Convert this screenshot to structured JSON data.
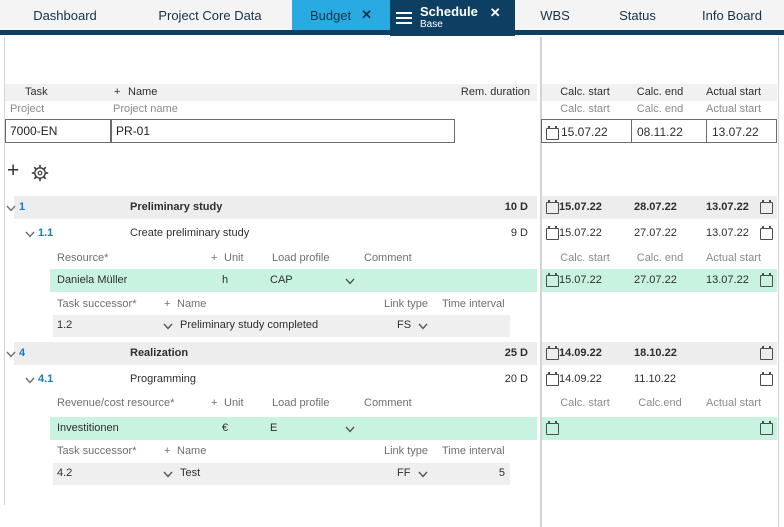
{
  "tabs": {
    "dashboard": "Dashboard",
    "project_core_data": "Project Core Data",
    "budget": "Budget",
    "budget_close": "✕",
    "schedule": "Schedule",
    "schedule_sub": "Base",
    "schedule_close": "✕",
    "wbs": "WBS",
    "status": "Status",
    "info_board": "Info Board"
  },
  "colors": {
    "accent_blue": "#29abe2",
    "navy": "#0d3f63",
    "mint_row": "#c8f3e1",
    "gray_row": "#ededee",
    "task_number_blue": "#1878c2"
  },
  "header": {
    "task": "Task",
    "plus": "+",
    "name": "Name",
    "rem_duration": "Rem. duration",
    "calc_start": "Calc. start",
    "calc_end": "Calc. end",
    "actual_start": "Actual start"
  },
  "project_row": {
    "task_label": "Project",
    "name_label": "Project name",
    "calc_start": "Calc. start",
    "calc_end": "Calc. end",
    "actual_start": "Actual start"
  },
  "project": {
    "id": "7000-EN",
    "name": "PR-01",
    "calc_start": "15.07.22",
    "calc_end": "08.11.22",
    "actual_start": "13.07.22"
  },
  "tasks": {
    "r1": {
      "num": "1",
      "name": "Preliminary study",
      "dur": "10 D",
      "calc_start": "15.07.22",
      "calc_end": "28.07.22",
      "actual_start": "13.07.22"
    },
    "r11": {
      "num": "1.1",
      "name": "Create preliminary study",
      "dur": "9 D",
      "calc_start": "15.07.22",
      "calc_end": "27.07.22",
      "actual_start": "13.07.22"
    },
    "r4": {
      "num": "4",
      "name": "Realization",
      "dur": "25 D",
      "calc_start": "14.09.22",
      "calc_end": "18.10.22",
      "actual_start": ""
    },
    "r41": {
      "num": "4.1",
      "name": "Programming",
      "dur": "20 D",
      "calc_start": "14.09.22",
      "calc_end": "11.10.22",
      "actual_start": ""
    }
  },
  "resource_section": {
    "header": {
      "col1": "Resource*",
      "plus": "+",
      "unit": "Unit",
      "load_profile": "Load profile",
      "comment": "Comment",
      "calc_start": "Calc. start",
      "calc_end": "Calc. end",
      "actual_start": "Actual start"
    },
    "row": {
      "name": "Daniela Müller",
      "unit": "h",
      "load_profile": "CAP",
      "calc_start": "15.07.22",
      "calc_end": "27.07.22",
      "actual_start": "13.07.22"
    }
  },
  "successor_section1": {
    "header": {
      "col1": "Task successor*",
      "plus": "+",
      "name": "Name",
      "link_type": "Link type",
      "time_interval": "Time interval"
    },
    "row": {
      "id": "1.2",
      "name": "Preliminary study completed",
      "link_type": "FS",
      "time_interval": ""
    }
  },
  "revenue_section": {
    "header": {
      "col1": "Revenue/cost resource*",
      "plus": "+",
      "unit": "Unit",
      "load_profile": "Load profile",
      "comment": "Comment",
      "calc_start": "Calc. start",
      "calc_end": "Calc.end",
      "actual_start": "Actual start"
    },
    "row": {
      "name": "Investitionen",
      "unit": "€",
      "load_profile": "E",
      "calc_start": "",
      "calc_end": "",
      "actual_start": ""
    }
  },
  "successor_section2": {
    "header": {
      "col1": "Task successor*",
      "plus": "+",
      "name": "Name",
      "link_type": "Link type",
      "time_interval": "Time interval"
    },
    "row": {
      "id": "4.2",
      "name": "Test",
      "link_type": "FF",
      "time_interval": "5"
    }
  },
  "toolbar": {
    "add": "+"
  }
}
